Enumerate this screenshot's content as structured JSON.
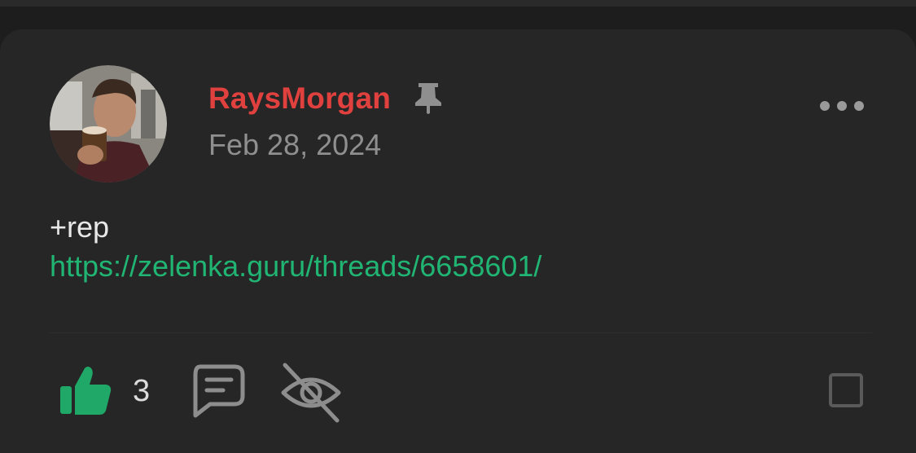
{
  "post": {
    "author": "RaysMorgan",
    "date": "Feb 28, 2024",
    "body_text": "+rep",
    "link_text": "https://zelenka.guru/threads/6658601/",
    "like_count": "3"
  },
  "icons": {
    "pin": "pin-icon",
    "more": "more-options-icon",
    "like": "thumbs-up-icon",
    "comment": "comment-icon",
    "hide": "eye-off-icon",
    "select": "checkbox"
  },
  "colors": {
    "author": "#e0413f",
    "link": "#21b574",
    "like": "#1fa868",
    "date": "#8f8f8f",
    "card_background": "#262626"
  }
}
